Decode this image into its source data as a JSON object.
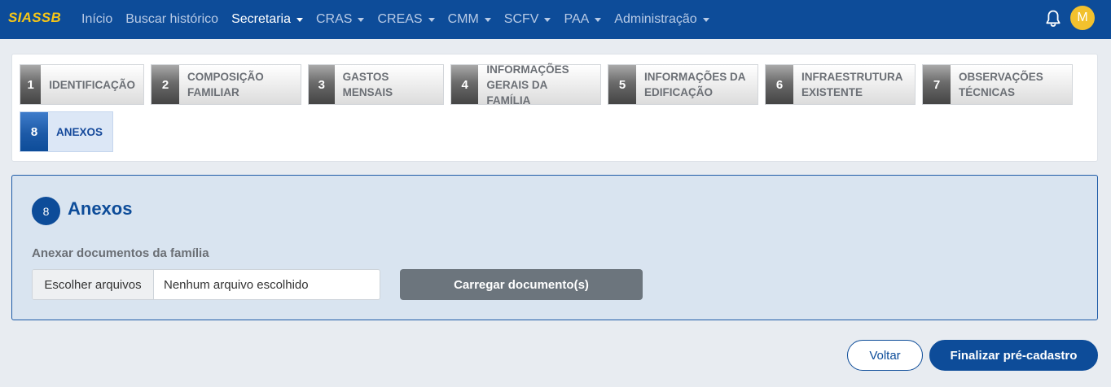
{
  "navbar": {
    "brand": "SIASSB",
    "items": [
      {
        "label": "Início"
      },
      {
        "label": "Buscar histórico"
      },
      {
        "label": "Secretaria"
      },
      {
        "label": "CRAS"
      },
      {
        "label": "CREAS"
      },
      {
        "label": "CMM"
      },
      {
        "label": "SCFV"
      },
      {
        "label": "PAA"
      },
      {
        "label": "Administração"
      }
    ],
    "active_item": "Secretaria",
    "bell_icon": "bell-icon",
    "avatar_initial": "M",
    "colors": {
      "background": "#0d4c99",
      "brand": "#f5c518",
      "avatar": "#f2c12e"
    }
  },
  "steps": [
    {
      "number": "1",
      "label_line1": "IDENTIFICAÇÃO",
      "label_line2": ""
    },
    {
      "number": "2",
      "label_line1": "COMPOSIÇÃO",
      "label_line2": "FAMILIAR"
    },
    {
      "number": "3",
      "label_line1": "GASTOS MENSAIS",
      "label_line2": ""
    },
    {
      "number": "4",
      "label_line1": "INFORMAÇÕES",
      "label_line2": "GERAIS DA FAMÍLIA"
    },
    {
      "number": "5",
      "label_line1": "INFORMAÇÕES DA",
      "label_line2": "EDIFICAÇÃO"
    },
    {
      "number": "6",
      "label_line1": "INFRAESTRUTURA",
      "label_line2": "EXISTENTE"
    },
    {
      "number": "7",
      "label_line1": "OBSERVAÇÕES",
      "label_line2": "TÉCNICAS"
    },
    {
      "number": "8",
      "label_line1": "ANEXOS",
      "label_line2": ""
    }
  ],
  "active_step": "8",
  "section": {
    "number": "8",
    "title": "Anexos",
    "field_label": "Anexar documentos da família",
    "file_button": "Escolher arquivos",
    "file_status": "Nenhum arquivo escolhido",
    "upload_button": "Carregar documento(s)"
  },
  "footer": {
    "back_button": "Voltar",
    "finish_button": "Finalizar pré-cadastro"
  }
}
